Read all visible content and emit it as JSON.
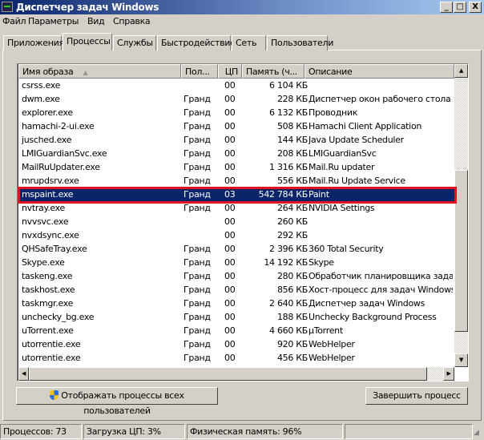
{
  "window": {
    "title": "Диспетчер задач Windows",
    "controls": [
      "_",
      "□",
      "X"
    ]
  },
  "menu": [
    "Файл",
    "Параметры",
    "Вид",
    "Справка"
  ],
  "tabs": [
    {
      "label": "Приложения"
    },
    {
      "label": "Процессы",
      "active": true
    },
    {
      "label": "Службы"
    },
    {
      "label": "Быстродействие"
    },
    {
      "label": "Сеть"
    },
    {
      "label": "Пользователи"
    }
  ],
  "columns": {
    "name": "Имя образа",
    "user": "Пол...",
    "cpu": "ЦП",
    "mem": "Память (ч...",
    "desc": "Описание"
  },
  "rows": [
    {
      "name": "csrss.exe",
      "user": "",
      "cpu": "00",
      "mem": "6 104 КБ",
      "desc": ""
    },
    {
      "name": "dwm.exe",
      "user": "Гранд",
      "cpu": "00",
      "mem": "228 КБ",
      "desc": "Диспетчер окон рабочего стола"
    },
    {
      "name": "explorer.exe",
      "user": "Гранд",
      "cpu": "00",
      "mem": "6 132 КБ",
      "desc": "Проводник"
    },
    {
      "name": "hamachi-2-ui.exe",
      "user": "Гранд",
      "cpu": "00",
      "mem": "508 КБ",
      "desc": "Hamachi Client Application"
    },
    {
      "name": "jusched.exe",
      "user": "Гранд",
      "cpu": "00",
      "mem": "144 КБ",
      "desc": "Java Update Scheduler"
    },
    {
      "name": "LMIGuardianSvc.exe",
      "user": "Гранд",
      "cpu": "00",
      "mem": "208 КБ",
      "desc": "LMIGuardianSvc"
    },
    {
      "name": "MailRuUpdater.exe",
      "user": "Гранд",
      "cpu": "00",
      "mem": "1 316 КБ",
      "desc": "Mail.Ru updater"
    },
    {
      "name": "mrupdsrv.exe",
      "user": "Гранд",
      "cpu": "00",
      "mem": "556 КБ",
      "desc": "Mail.Ru Update Service"
    },
    {
      "name": "mspaint.exe",
      "user": "Гранд",
      "cpu": "03",
      "mem": "542 784 КБ",
      "desc": "Paint",
      "selected": true
    },
    {
      "name": "nvtray.exe",
      "user": "Гранд",
      "cpu": "00",
      "mem": "264 КБ",
      "desc": "NVIDIA Settings"
    },
    {
      "name": "nvvsvc.exe",
      "user": "",
      "cpu": "00",
      "mem": "260 КБ",
      "desc": ""
    },
    {
      "name": "nvxdsync.exe",
      "user": "",
      "cpu": "00",
      "mem": "292 КБ",
      "desc": ""
    },
    {
      "name": "QHSafeTray.exe",
      "user": "Гранд",
      "cpu": "00",
      "mem": "2 396 КБ",
      "desc": "360 Total Security"
    },
    {
      "name": "Skype.exe",
      "user": "Гранд",
      "cpu": "00",
      "mem": "14 192 КБ",
      "desc": "Skype"
    },
    {
      "name": "taskeng.exe",
      "user": "Гранд",
      "cpu": "00",
      "mem": "280 КБ",
      "desc": "Обработчик планировщика заданий"
    },
    {
      "name": "taskhost.exe",
      "user": "Гранд",
      "cpu": "00",
      "mem": "856 КБ",
      "desc": "Хост-процесс для задач Windows"
    },
    {
      "name": "taskmgr.exe",
      "user": "Гранд",
      "cpu": "00",
      "mem": "2 640 КБ",
      "desc": "Диспетчер задач Windows"
    },
    {
      "name": "unchecky_bg.exe",
      "user": "Гранд",
      "cpu": "00",
      "mem": "188 КБ",
      "desc": "Unchecky Background Process"
    },
    {
      "name": "uTorrent.exe",
      "user": "Гранд",
      "cpu": "00",
      "mem": "4 660 КБ",
      "desc": "µTorrent"
    },
    {
      "name": "utorrentie.exe",
      "user": "Гранд",
      "cpu": "00",
      "mem": "920 КБ",
      "desc": "WebHelper"
    },
    {
      "name": "utorrentie.exe",
      "user": "Гранд",
      "cpu": "00",
      "mem": "456 КБ",
      "desc": "WebHelper"
    }
  ],
  "buttons": {
    "show_all": "Отображать процессы всех пользователей",
    "end_process": "Завершить процесс"
  },
  "status": {
    "processes": "Процессов: 73",
    "cpu": "Загрузка ЦП: 3%",
    "memory": "Физическая память: 96%"
  },
  "colors": {
    "selection": "#0a246a",
    "highlight_box": "#e0141e"
  }
}
